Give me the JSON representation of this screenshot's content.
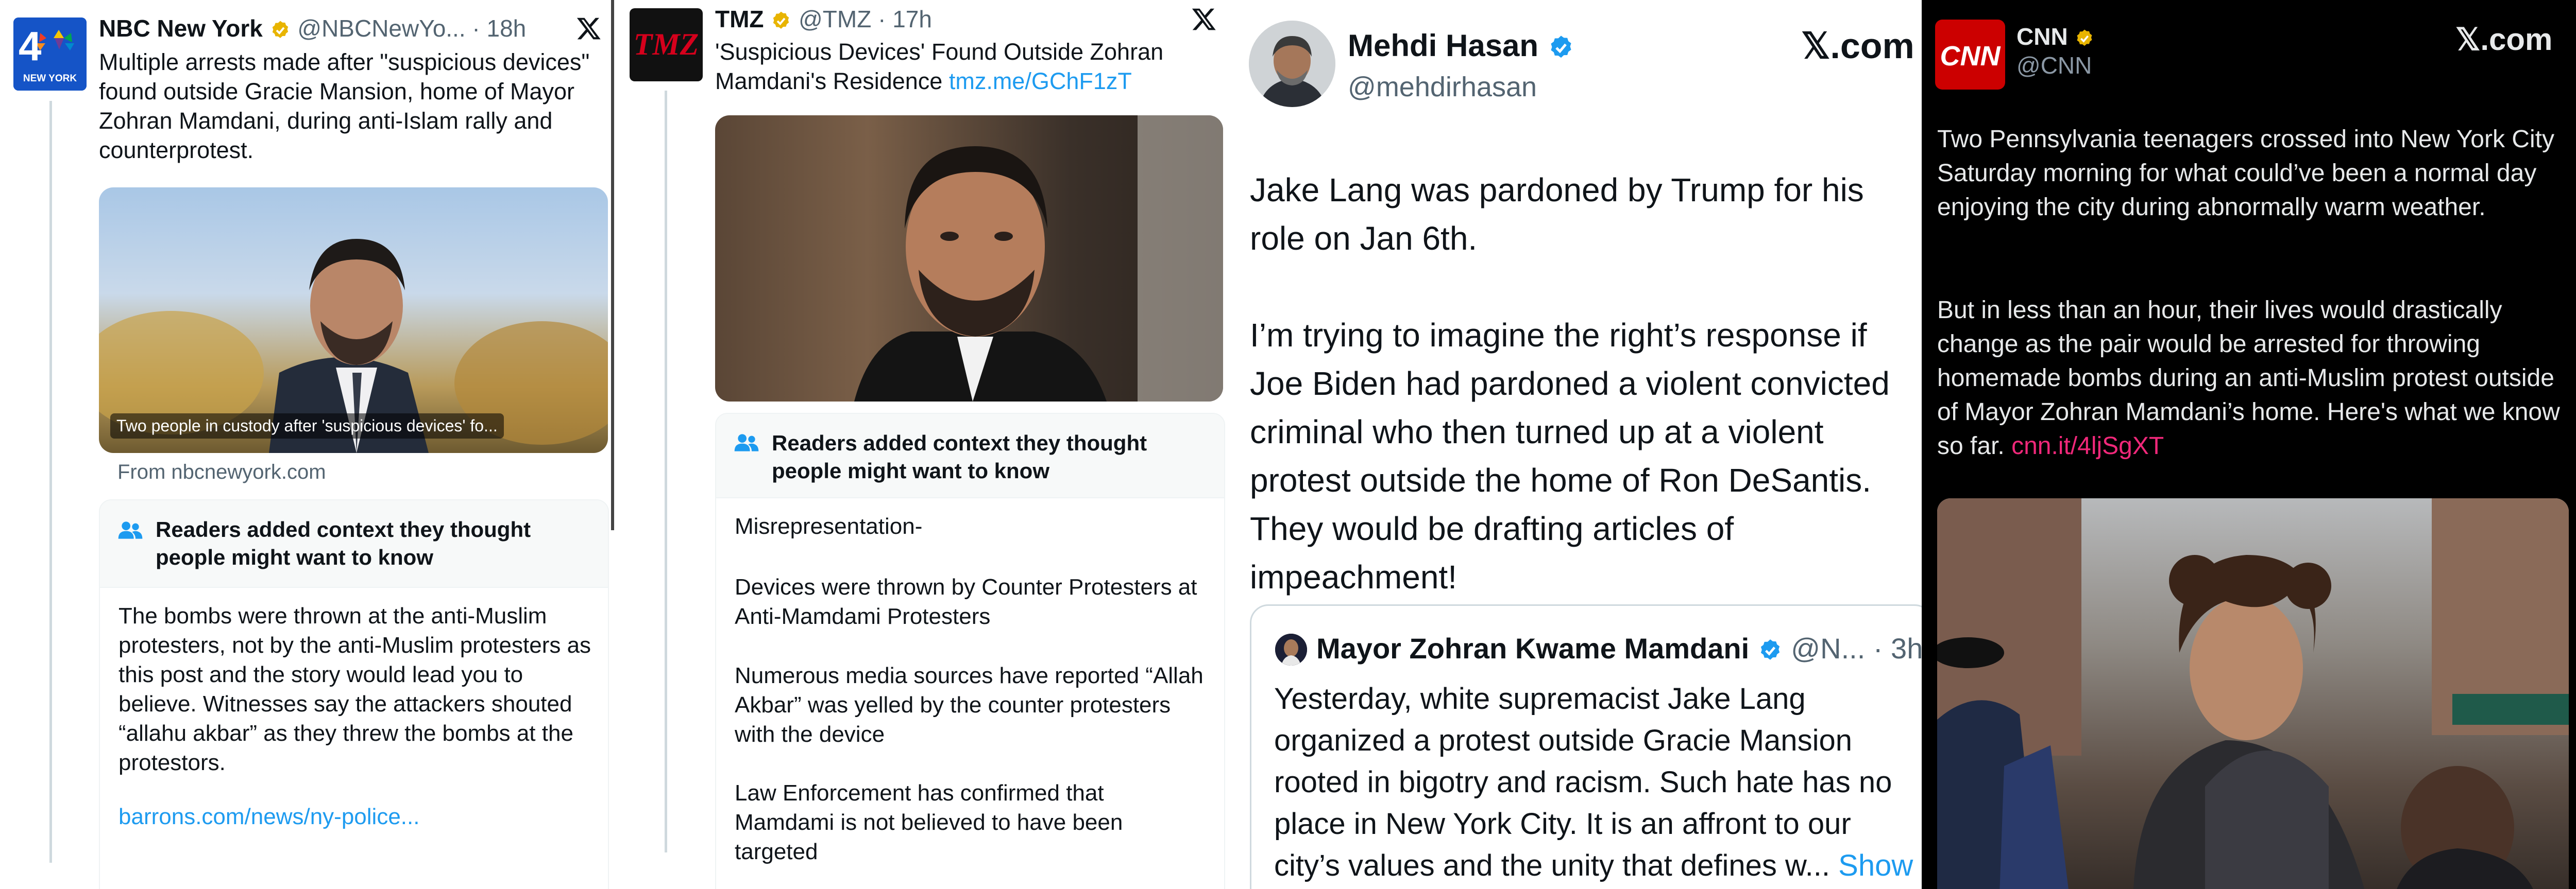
{
  "panel1": {
    "author_name": "NBC New York",
    "handle": "@NBCNewYo...",
    "dot": "·",
    "time": "18h",
    "logo_number": "4",
    "logo_text": "NEW YORK",
    "text": "Multiple arrests made after \"suspicious devices\" found outside Gracie Mansion, home of Mayor Zohran Mamdani, during anti-Islam rally and counterprotest.",
    "image_caption": "Two people in custody after 'suspicious devices' fo...",
    "source": "From nbcnewyork.com",
    "note_header": "Readers added context they thought people might want to know",
    "note_body": "The bombs were thrown at the anti-Muslim protesters, not by the anti-Muslim protesters as this post and the story would lead you to believe. Witnesses say the attackers shouted “allahu akbar” as they threw the bombs at the protestors.",
    "note_link": "barrons.com/news/ny-police..."
  },
  "panel2": {
    "author_name": "TMZ",
    "handle": "@TMZ",
    "dot": "·",
    "time": "17h",
    "logo_text": "TMZ",
    "text": "'Suspicious Devices' Found Outside Zohran Mamdani's Residence",
    "link": "tmz.me/GChF1zT",
    "note_header": "Readers added context they thought people might want to know",
    "note_p1": "Misrepresentation-",
    "note_p2": "Devices were thrown by Counter Protesters at Anti-Mamdami Protesters",
    "note_p3": "Numerous media sources have reported “Allah Akbar” was yelled by the counter protesters with the device",
    "note_p4": "Law Enforcement has confirmed that Mamdami is not believed to have been targeted"
  },
  "panel3": {
    "author_name": "Mehdi Hasan",
    "handle": "@mehdirhasan",
    "brand": "X.com",
    "brand_x": "𝕏",
    "brand_rest": ".com",
    "text_p1": "Jake Lang was pardoned by Trump for his role on Jan 6th.",
    "text_p2": "I’m trying to imagine the right’s response if Joe Biden had pardoned a violent convicted criminal who then turned up at a violent protest outside the home of Ron DeSantis. They would be drafting articles of impeachment!",
    "quote": {
      "author_name": "Mayor Zohran Kwame Mamdani",
      "handle": "@N...",
      "dot": "·",
      "time": "3h",
      "text": "Yesterday, white supremacist Jake Lang organized a protest outside Gracie Mansion rooted in bigotry and racism. Such hate has no place in New York City. It is an affront to our city’s values and the unity that defines w...",
      "show_more": "Show more"
    }
  },
  "panel4": {
    "author_name": "CNN",
    "handle": "@CNN",
    "logo_text": "CNN",
    "brand_x": "𝕏",
    "brand_rest": ".com",
    "text_p1": "Two Pennsylvania teenagers crossed into New York City Saturday morning for what could’ve been a normal day enjoying the city during abnormally warm weather.",
    "text_p2": "But in less than an hour, their lives would drastically change as the pair would be arrested for throwing homemade bombs during an anti-Muslim protest outside of Mayor Zohran Mamdani’s home. Here's what we know so far.",
    "link": "cnn.it/4ljSgXT"
  },
  "colors": {
    "x_blue": "#1d9bf0",
    "verified_gold": "#e8b400",
    "cnn_pink": "#f0287a",
    "cnn_red": "#cc0000",
    "tmz_red": "#d6001c",
    "nbc_blue": "#1554c7"
  },
  "icons": [
    "verified-gold-icon",
    "verified-blue-icon",
    "x-logo-icon",
    "people-icon"
  ]
}
